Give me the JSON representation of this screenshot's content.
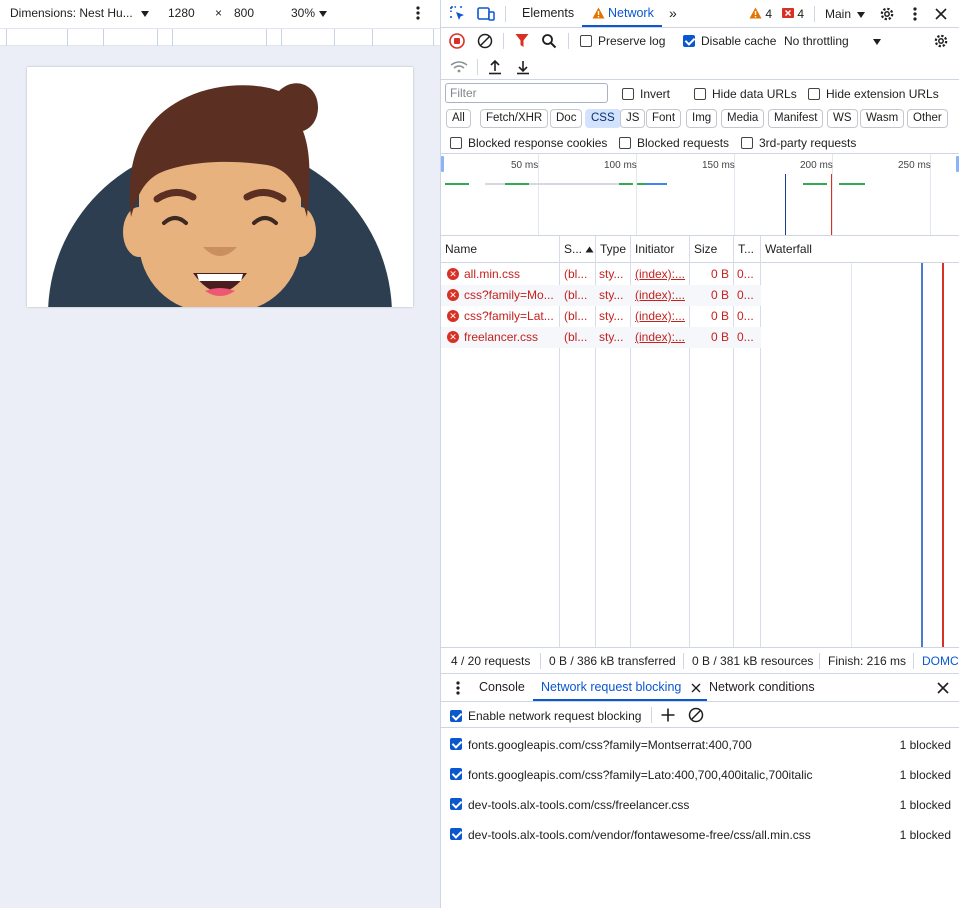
{
  "device_toolbar": {
    "dimensions_label": "Dimensions: Nest Hu...",
    "width": "1280",
    "times": "×",
    "height": "800",
    "zoom": "30%"
  },
  "devtools": {
    "tabs": [
      "Elements",
      "Network"
    ],
    "more_tabs": "»",
    "warnings_count": "4",
    "errors_count": "4",
    "context": "Main",
    "toolbar": {
      "preserve_log": "Preserve log",
      "disable_cache": "Disable cache",
      "throttling": "No throttling"
    },
    "filter": {
      "placeholder": "Filter",
      "invert": "Invert",
      "hide_data_urls": "Hide data URLs",
      "hide_extension_urls": "Hide extension URLs"
    },
    "types": [
      "All",
      "Fetch/XHR",
      "Doc",
      "CSS",
      "JS",
      "Font",
      "Img",
      "Media",
      "Manifest",
      "WS",
      "Wasm",
      "Other"
    ],
    "active_type": "CSS",
    "blocked_filters": {
      "blocked_response_cookies": "Blocked response cookies",
      "blocked_requests": "Blocked requests",
      "third_party": "3rd-party requests"
    },
    "overview_ticks": [
      "50 ms",
      "100 ms",
      "150 ms",
      "200 ms",
      "250 ms"
    ],
    "columns": [
      "Name",
      "S...",
      "Type",
      "Initiator",
      "Size",
      "T...",
      "Waterfall"
    ],
    "requests": [
      {
        "name": "all.min.css",
        "status": "(bl...",
        "type": "sty...",
        "initiator": "(index):...",
        "size": "0 B",
        "time": "0..."
      },
      {
        "name": "css?family=Mo...",
        "status": "(bl...",
        "type": "sty...",
        "initiator": "(index):...",
        "size": "0 B",
        "time": "0..."
      },
      {
        "name": "css?family=Lat...",
        "status": "(bl...",
        "type": "sty...",
        "initiator": "(index):...",
        "size": "0 B",
        "time": "0..."
      },
      {
        "name": "freelancer.css",
        "status": "(bl...",
        "type": "sty...",
        "initiator": "(index):...",
        "size": "0 B",
        "time": "0..."
      }
    ],
    "status": {
      "requests": "4 / 20 requests",
      "transferred": "0 B / 386 kB transferred",
      "resources": "0 B / 381 kB resources",
      "finish": "Finish: 216 ms",
      "domc": "DOMC"
    },
    "drawer": {
      "tabs": [
        "Console",
        "Network request blocking",
        "Network conditions"
      ],
      "enable_label": "Enable network request blocking",
      "patterns": [
        {
          "url": "fonts.googleapis.com/css?family=Montserrat:400,700",
          "count": "1 blocked"
        },
        {
          "url": "fonts.googleapis.com/css?family=Lato:400,700,400italic,700italic",
          "count": "1 blocked"
        },
        {
          "url": "dev-tools.alx-tools.com/css/freelancer.css",
          "count": "1 blocked"
        },
        {
          "url": "dev-tools.alx-tools.com/vendor/fontawesome-free/css/all.min.css",
          "count": "1 blocked"
        }
      ]
    }
  },
  "colors": {
    "accent": "#0b57d0",
    "error": "#c5221f",
    "warning": "#e37400"
  }
}
